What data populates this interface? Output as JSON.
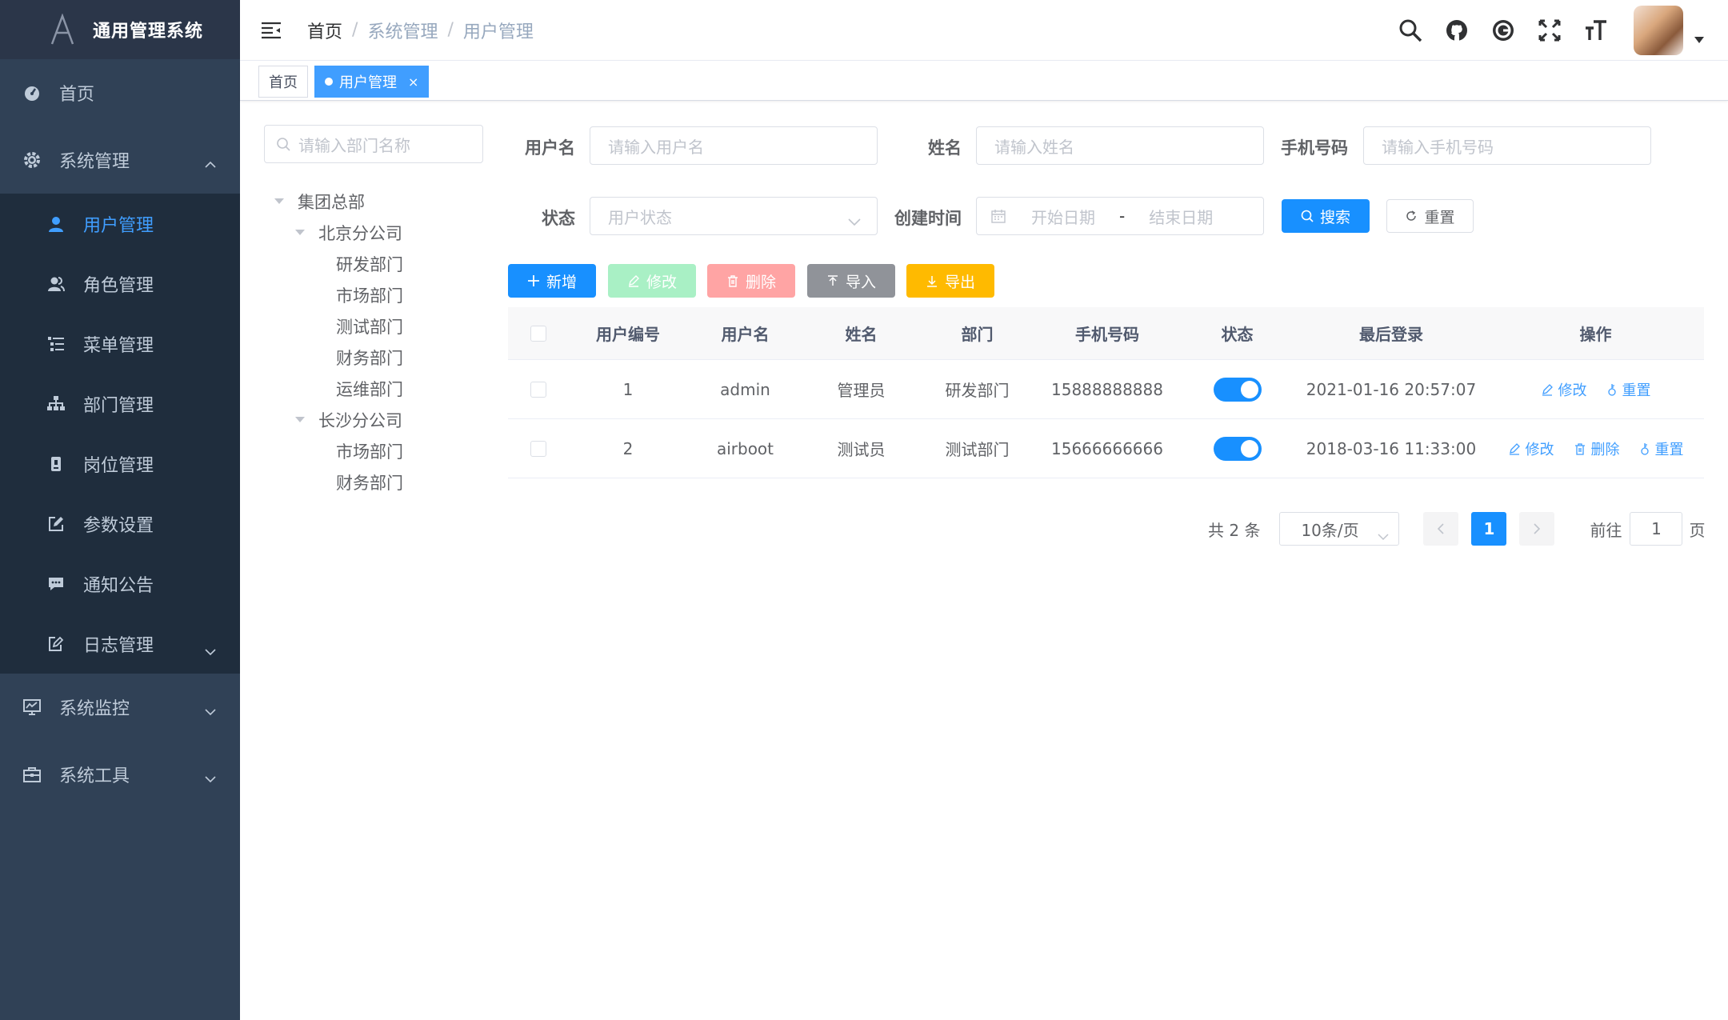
{
  "app": {
    "title": "通用管理系统"
  },
  "sidebar": {
    "items": [
      {
        "label": "首页"
      },
      {
        "label": "系统管理"
      },
      {
        "label": "系统监控"
      },
      {
        "label": "系统工具"
      }
    ],
    "submenu": [
      {
        "label": "用户管理"
      },
      {
        "label": "角色管理"
      },
      {
        "label": "菜单管理"
      },
      {
        "label": "部门管理"
      },
      {
        "label": "岗位管理"
      },
      {
        "label": "参数设置"
      },
      {
        "label": "通知公告"
      },
      {
        "label": "日志管理"
      }
    ]
  },
  "breadcrumb": [
    "首页",
    "系统管理",
    "用户管理"
  ],
  "breadcrumb_sep": "/",
  "tags": [
    {
      "label": "首页"
    },
    {
      "label": "用户管理",
      "close": "×"
    }
  ],
  "tree": {
    "search_placeholder": "请输入部门名称",
    "nodes": [
      {
        "label": "集团总部"
      },
      {
        "label": "北京分公司"
      },
      {
        "label": "研发部门"
      },
      {
        "label": "市场部门"
      },
      {
        "label": "测试部门"
      },
      {
        "label": "财务部门"
      },
      {
        "label": "运维部门"
      },
      {
        "label": "长沙分公司"
      },
      {
        "label": "市场部门"
      },
      {
        "label": "财务部门"
      }
    ]
  },
  "query": {
    "username_label": "用户名",
    "username_placeholder": "请输入用户名",
    "name_label": "姓名",
    "name_placeholder": "请输入姓名",
    "phone_label": "手机号码",
    "phone_placeholder": "请输入手机号码",
    "status_label": "状态",
    "status_placeholder": "用户状态",
    "created_label": "创建时间",
    "start_placeholder": "开始日期",
    "range_sep": "-",
    "end_placeholder": "结束日期",
    "search_label": "搜索",
    "reset_label": "重置"
  },
  "toolbar": {
    "add": "新增",
    "edit": "修改",
    "delete": "删除",
    "import": "导入",
    "export": "导出"
  },
  "table": {
    "headers": [
      "用户编号",
      "用户名",
      "姓名",
      "部门",
      "手机号码",
      "状态",
      "最后登录",
      "操作"
    ],
    "rows": [
      {
        "id": "1",
        "username": "admin",
        "name": "管理员",
        "dept": "研发部门",
        "phone": "15888888888",
        "status": true,
        "last_login": "2021-01-16 20:57:07",
        "actions": [
          "修改",
          "重置"
        ]
      },
      {
        "id": "2",
        "username": "airboot",
        "name": "测试员",
        "dept": "测试部门",
        "phone": "15666666666",
        "status": true,
        "last_login": "2018-03-16 11:33:00",
        "actions": [
          "修改",
          "删除",
          "重置"
        ]
      }
    ]
  },
  "pagination": {
    "total_text": "共 2 条",
    "page_size": "10条/页",
    "current_page": "1",
    "goto_label": "前往",
    "goto_value": "1",
    "page_unit": "页"
  },
  "colors": {
    "sidebar_bg": "#304156",
    "submenu_bg": "#1f2d3d",
    "primary": "#1890ff",
    "success": "#13ce66",
    "danger": "#ff4949",
    "info": "#909399",
    "warning": "#ffba00"
  }
}
